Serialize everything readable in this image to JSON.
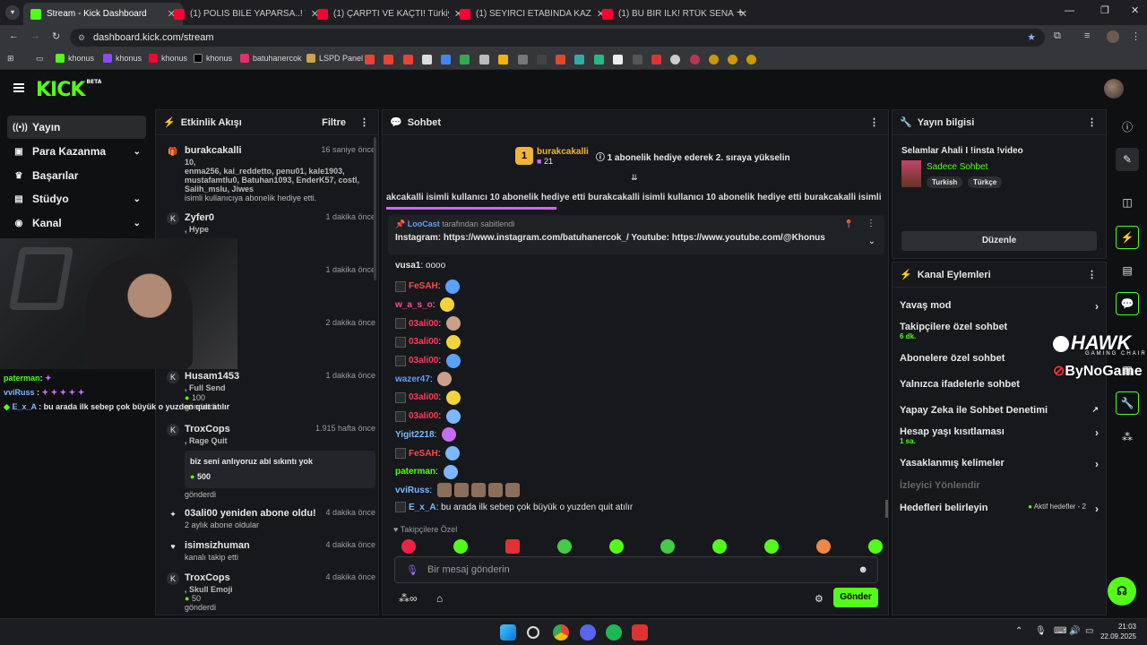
{
  "browser": {
    "tabs": [
      {
        "title": "Stream - Kick Dashboard",
        "active": true
      },
      {
        "title": "(1) POLİS BİLE YAPARSA..! Türkiye",
        "active": false
      },
      {
        "title": "(1) ÇARPTI VE KAÇTI! Türkiye'de",
        "active": false
      },
      {
        "title": "(1) SEYİRCİ ETABINDA KAZA | 5",
        "active": false
      },
      {
        "title": "(1) BU BİR İLK! RTÜK SENARYO",
        "active": false
      }
    ],
    "url": "dashboard.kick.com/stream",
    "bookmarks": [
      "khonus",
      "khonus",
      "khonus",
      "khonus",
      "batuhanercok",
      "LSPD Panel"
    ]
  },
  "kick": {
    "logo": "KICK",
    "logo_badge": "BETA"
  },
  "nav": [
    {
      "label": "Yayın",
      "icon": "broadcast-icon",
      "chev": false,
      "active": true
    },
    {
      "label": "Para Kazanma",
      "icon": "money-icon",
      "chev": true
    },
    {
      "label": "Başarılar",
      "icon": "trophy-icon",
      "chev": false
    },
    {
      "label": "Stüdyo",
      "icon": "studio-icon",
      "chev": true
    },
    {
      "label": "Kanal",
      "icon": "channel-icon",
      "chev": true
    }
  ],
  "overlay_chat": [
    {
      "user": "paterman",
      "text": ""
    },
    {
      "user": "vviRuss",
      "text": ""
    },
    {
      "user": "E_x_A",
      "text": "bu arada ilk sebep çok büyük o yuzden quit atılır"
    }
  ],
  "activity": {
    "title": "Etkinlik Akışı",
    "filter": "Filtre",
    "items": [
      {
        "user": "burakcakalli",
        "time": "16 saniye önce",
        "list": "10,",
        "list2": "enma256, kai_reddetto, penu01, kale1903,",
        "list3": "mustafamtlu0, Batuhan1093, EnderK57, costl,",
        "list4": "Salih_mslu, Jiwes",
        "desc": "isimli kullanıcıya abonelik hediye etti."
      },
      {
        "user": "Zyfer0",
        "time": "1 dakika önce",
        "sub": ", Hype"
      },
      {
        "user": "",
        "time": "1 dakika önce"
      },
      {
        "user": "",
        "time": "2 dakika önce"
      },
      {
        "user": "Husam1453",
        "time": "1 dakika önce",
        "sub": ", Full Send",
        "amount": "100",
        "desc": "gönderdi"
      },
      {
        "user": "TroxCops",
        "time": "1.915 hafta önce",
        "sub": ", Rage Quit",
        "msg": "biz seni anlıyoruz abi sıkıntı yok",
        "amount": "500",
        "desc": "gönderdi"
      },
      {
        "user": "03ali00 yeniden abone oldu!",
        "time": "4 dakika önce",
        "desc": "2 aylık abone oldular"
      },
      {
        "user": "isimsizhuman",
        "time": "4 dakika önce",
        "desc": "kanalı takip etti"
      },
      {
        "user": "TroxCops",
        "time": "4 dakika önce",
        "sub": ", Skull Emoji",
        "amount": "50",
        "desc": "gönderdi"
      }
    ]
  },
  "chat": {
    "title": "Sohbet",
    "gift_user": "burakcakalli",
    "gift_count": "21",
    "gift_text": "1 abonelik hediye ederek 2. sıraya yükselin",
    "ticker": "akcakalli isimli kullanıcı 10 abonelik hediye etti  burakcakalli isimli kullanıcı 10 abonelik hediye etti  burakcakalli isimli",
    "pinned_by": "LooCast",
    "pinned_suffix": "tarafından sabitlendi",
    "pinned_text": "Instagram: https://www.instagram.com/batuhanercok_/ Youtube: https://www.youtube.com/@Khonus",
    "lines": [
      {
        "user": "vusa1",
        "text": "oooo",
        "color": "#e6e6e6",
        "badge": false
      },
      {
        "user": "FeSAH",
        "text": "",
        "color": "#ff4a4a",
        "badge": true
      },
      {
        "user": "w_a_s_o",
        "text": "",
        "color": "#ff4a9a",
        "badge": false
      },
      {
        "user": "03ali00",
        "text": "",
        "color": "#ff3b5c",
        "badge": true
      },
      {
        "user": "03ali00",
        "text": "",
        "color": "#ff3b5c",
        "badge": true
      },
      {
        "user": "03ali00",
        "text": "",
        "color": "#ff3b5c",
        "badge": true
      },
      {
        "user": "wazer47",
        "text": "",
        "color": "#5aa0ff",
        "badge": false
      },
      {
        "user": "03ali00",
        "text": "",
        "color": "#ff3b5c",
        "badge": true
      },
      {
        "user": "03ali00",
        "text": "",
        "color": "#ff3b5c",
        "badge": true
      },
      {
        "user": "Yigit2218",
        "text": "",
        "color": "#7ab8ff",
        "badge": false
      },
      {
        "user": "FeSAH",
        "text": "",
        "color": "#ff4a4a",
        "badge": true
      },
      {
        "user": "paterman",
        "text": "",
        "color": "#53fc18",
        "badge": false
      },
      {
        "user": "vviRuss",
        "text": "",
        "color": "#7ab8ff",
        "badge": false
      },
      {
        "user": "E_x_A",
        "text": "bu arada ilk sebep çok büyük o yuzden quit atılır",
        "color": "#7ab8ff",
        "badge": true
      }
    ],
    "followers_only": "Takipçilere Özel",
    "placeholder": "Bir mesaj gönderin",
    "send": "Gönder"
  },
  "stream_info": {
    "title": "Yayın bilgisi",
    "stream_title": "Selamlar Ahali I !insta !video",
    "category": "Sadece Sohbet",
    "tags": [
      "Turkish",
      "Türkçe"
    ],
    "edit": "Düzenle"
  },
  "channel_actions": {
    "title": "Kanal Eylemleri",
    "items": [
      {
        "label": "Yavaş mod",
        "sub": "",
        "chev": true
      },
      {
        "label": "Takipçilere özel sohbet",
        "sub": "6 dk.",
        "chev": false
      },
      {
        "label": "Abonelere özel sohbet",
        "sub": "",
        "chev": false
      },
      {
        "label": "Yalnızca ifadelerle sohbet",
        "sub": "",
        "chev": false
      },
      {
        "label": "Yapay Zeka ile Sohbet Denetimi",
        "sub": "",
        "chev": false
      },
      {
        "label": "Hesap yaşı kısıtlaması",
        "sub": "1 sa.",
        "chev": true
      },
      {
        "label": "Yasaklanmış kelimeler",
        "sub": "",
        "chev": true
      },
      {
        "label": "İzleyici Yönlendir",
        "sub": "",
        "chev": false,
        "disabled": true
      },
      {
        "label": "Hedefleri belirleyin",
        "sub": "",
        "chev": true
      }
    ],
    "goals_status": "Aktif hedefler - 2"
  },
  "watermark": {
    "brand1": "HAWK",
    "brand1_sub": "GAMING CHAIR",
    "brand2": "ByNoGame"
  },
  "taskbar": {
    "time": "21:03",
    "date": "22.09.2025"
  },
  "colors": {
    "accent": "#53fc18",
    "bg": "#0f1012",
    "panel": "#17181b"
  }
}
